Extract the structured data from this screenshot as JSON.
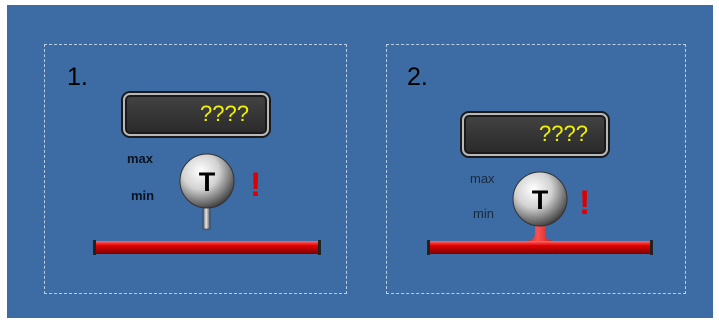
{
  "panels": [
    {
      "number": "1.",
      "display_value": "????",
      "max_label": "max",
      "min_label": "min",
      "sensor_letter": "T",
      "alert_symbol": "!"
    },
    {
      "number": "2.",
      "display_value": "????",
      "max_label": "max",
      "min_label": "min",
      "sensor_letter": "T",
      "alert_symbol": "!"
    }
  ],
  "colors": {
    "background": "#3d6ba3",
    "display_text": "#f2f300",
    "pipe": "#d40000",
    "alert": "#e00000"
  },
  "icons": [
    "temperature-sensor-icon",
    "alert-icon",
    "pipe-icon"
  ]
}
